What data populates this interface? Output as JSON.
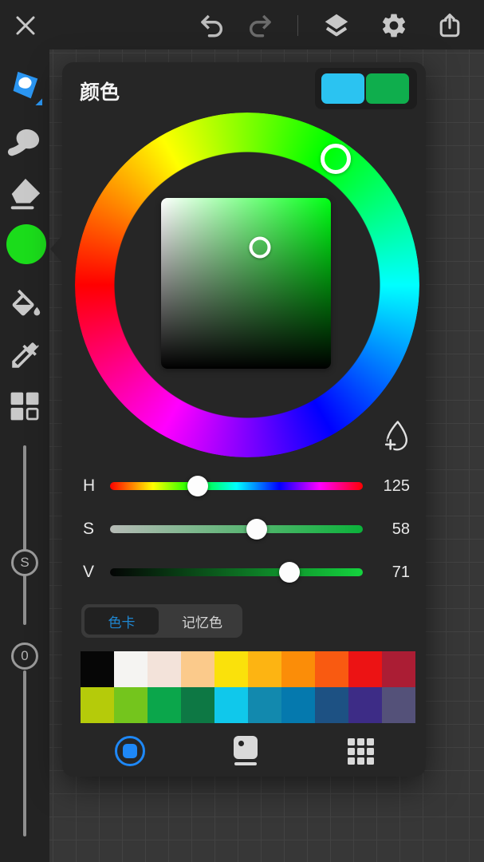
{
  "toolbar": {
    "icons": [
      "close-icon",
      "undo-icon",
      "redo-icon",
      "layers-icon",
      "settings-icon",
      "share-icon"
    ],
    "redo_disabled": true
  },
  "sidebar": {
    "tools": [
      "brush",
      "smudge",
      "eraser",
      "color",
      "fill-bucket",
      "eyedropper",
      "swatch-grid"
    ],
    "active_tool": "color",
    "current_color": "#1bdc1b",
    "size_slider": {
      "label": "S"
    },
    "opacity_slider": {
      "label": "0"
    }
  },
  "panel": {
    "title": "颜色",
    "recent_colors": [
      "#2bc3f1",
      "#0fae4d"
    ],
    "hsv": {
      "h": 125,
      "s": 58,
      "v": 71
    },
    "sliders": [
      {
        "label": "H",
        "value": "125",
        "max": 360,
        "track": "linear-gradient(to right,#ff0000,#ffff00 17%,#00ff00 33%,#00ffff 50%,#0000ff 67%,#ff00ff 83%,#ff0000)"
      },
      {
        "label": "S",
        "value": "58",
        "max": 100,
        "track": "linear-gradient(to right,#b6bab6,#0bb23a)"
      },
      {
        "label": "V",
        "value": "71",
        "max": 100,
        "track": "linear-gradient(to right,#040404,#14d33e)"
      }
    ],
    "tabs": [
      {
        "label": "色卡",
        "active": true
      },
      {
        "label": "记忆色",
        "active": false
      }
    ],
    "palette": [
      [
        "#060606",
        "#f5f4f2",
        "#f3e3da",
        "#fbca8b",
        "#fae10b",
        "#fdb412",
        "#fb8d08",
        "#f95a11",
        "#ec1314",
        "#ab1d34"
      ],
      [
        "#b5cb0a",
        "#74c51d",
        "#0ba64b",
        "#0d7844",
        "#10c8eb",
        "#1289ae",
        "#0579ae",
        "#1d5183",
        "#3d2c86",
        "#545179"
      ]
    ],
    "modes": [
      "wheel-mode",
      "card-mode",
      "grid-mode"
    ],
    "active_mode": "wheel-mode",
    "accent": "#1e88f7",
    "add_color_icon": "droplet-plus-icon"
  }
}
